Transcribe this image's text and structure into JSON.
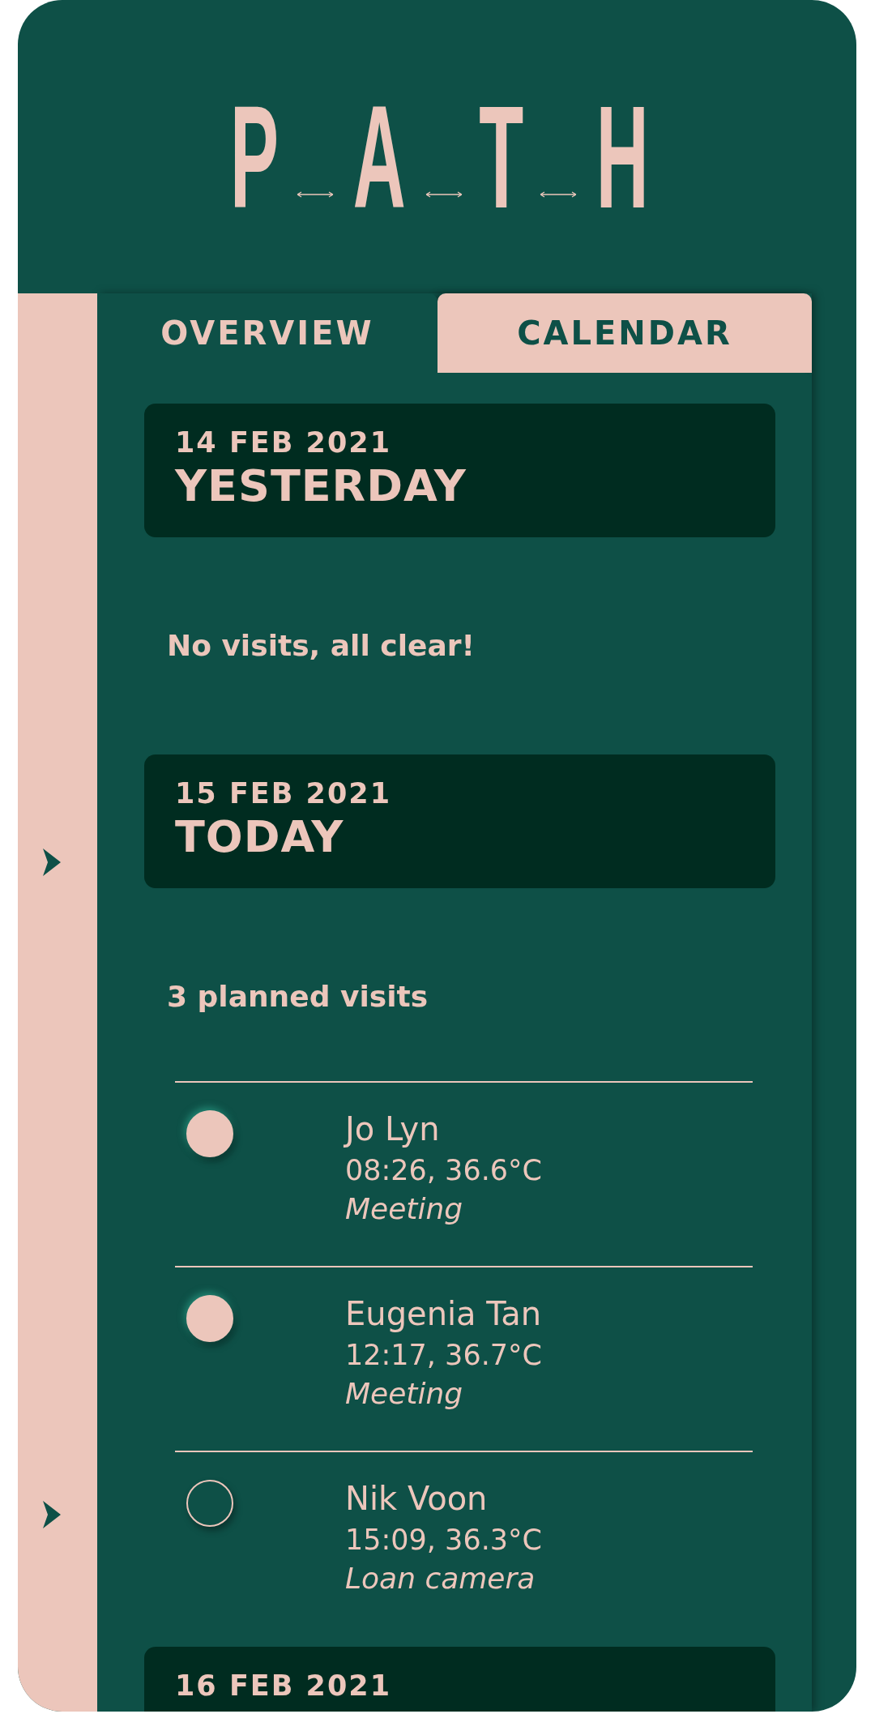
{
  "logo": {
    "letters": [
      "P",
      "A",
      "T",
      "H"
    ]
  },
  "tabs": [
    {
      "label": "OVERVIEW",
      "selected": true
    },
    {
      "label": "CALENDAR",
      "selected": false
    }
  ],
  "days": [
    {
      "date": "14 FEB 2021",
      "title": "YESTERDAY",
      "summary": "No visits, all clear!"
    },
    {
      "date": "15 FEB 2021",
      "title": "TODAY",
      "summary": "3 planned visits",
      "visits": [
        {
          "name": "Jo Lyn",
          "details": "08:26, 36.6°C",
          "purpose": "Meeting",
          "checked": true
        },
        {
          "name": "Eugenia Tan",
          "details": "12:17, 36.7°C",
          "purpose": "Meeting",
          "checked": true
        },
        {
          "name": "Nik Voon",
          "details": "15:09, 36.3°C",
          "purpose": "Loan camera",
          "checked": false
        }
      ]
    },
    {
      "date": "16 FEB 2021"
    }
  ]
}
